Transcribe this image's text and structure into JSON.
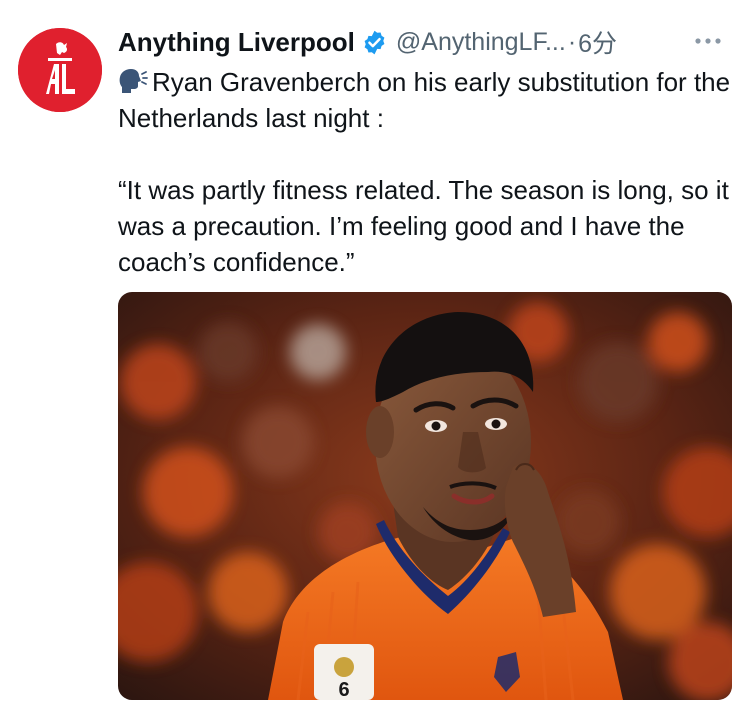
{
  "tweet": {
    "author": {
      "display_name": "Anything Liverpool",
      "handle": "@AnythingLF...",
      "avatar_initials": "AL",
      "verified": true,
      "avatar_color": "#e0202e"
    },
    "separator": "·",
    "time": "6分",
    "text_line_1": "Ryan Gravenberch on his early substitution for the Netherlands last night :",
    "text_line_2": "“It was partly fitness related. The season is long, so it was a precaution. I’m feeling good and I have the coach’s confidence.”",
    "emoji_icon": "speaking-head-icon",
    "media": {
      "description_icon": "photo",
      "badge_text": "6"
    }
  },
  "colors": {
    "accent": "#1d9bf0",
    "secondary_text": "#536471",
    "primary_text": "#0f1419",
    "jersey": "#f26a1b"
  }
}
